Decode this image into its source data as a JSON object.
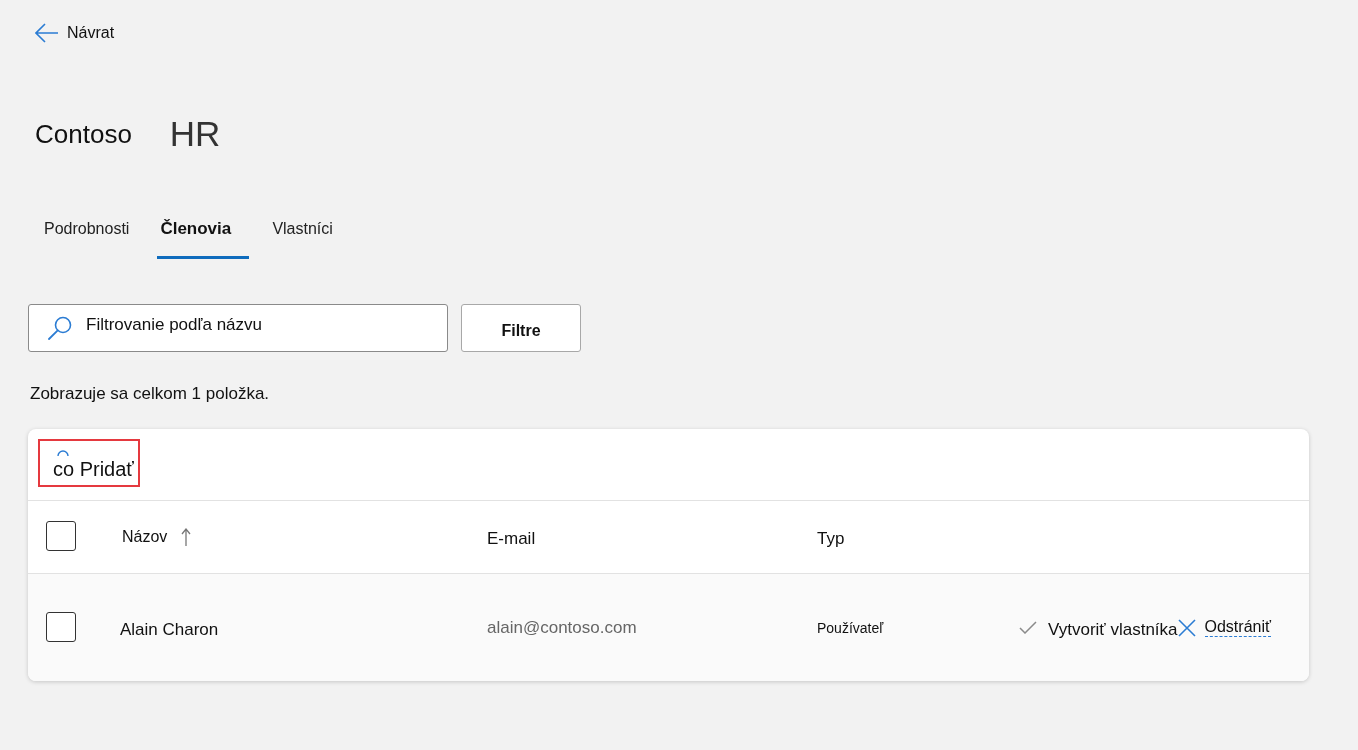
{
  "back_link": {
    "label": "Návrat"
  },
  "header": {
    "org": "Contoso",
    "group": "HR"
  },
  "tabs": [
    {
      "label": "Podrobnosti",
      "selected": false
    },
    {
      "label": "Členovia",
      "selected": true
    },
    {
      "label": "Vlastníci",
      "selected": false
    }
  ],
  "search": {
    "placeholder": "Filtrovanie podľa názvu"
  },
  "filter_button": {
    "label": "Filtre"
  },
  "result_count": "Zobrazuje sa celkom 1 položka.",
  "members_table": {
    "toolbar": {
      "add_button": {
        "label": "co Pridať",
        "highlighted": true
      }
    },
    "select_all": {
      "checked": false
    },
    "columns": [
      {
        "label": "Názov",
        "sorted": true
      },
      {
        "label": "E-mail",
        "sorted": false
      },
      {
        "label": "Typ",
        "sorted": false
      }
    ],
    "rows": [
      {
        "checked": false,
        "name": "Alain Charon",
        "email": "alain@contoso.com",
        "type": "Používateľ",
        "actions": [
          {
            "kind": "make_owner",
            "label": "Vytvoriť vlastníka"
          },
          {
            "kind": "remove",
            "label": "Odstrániť"
          }
        ]
      }
    ]
  }
}
